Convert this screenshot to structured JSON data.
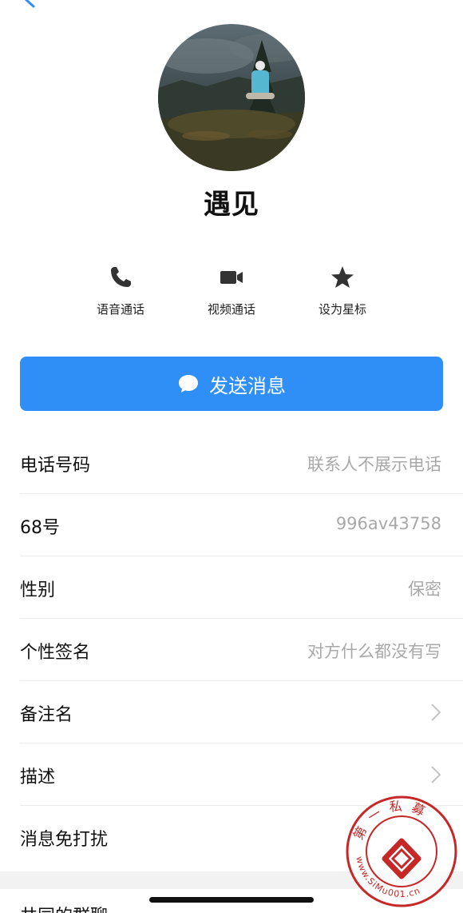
{
  "profile": {
    "name": "遇见"
  },
  "actions": [
    {
      "label": "语音通话",
      "icon": "phone-icon"
    },
    {
      "label": "视频通话",
      "icon": "video-camera-icon"
    },
    {
      "label": "设为星标",
      "icon": "star-icon"
    }
  ],
  "send_button": {
    "label": "发送消息",
    "icon": "chat-bubble-icon"
  },
  "info_rows": [
    {
      "key": "电话号码",
      "value": "联系人不展示电话"
    },
    {
      "key": "68号",
      "value": "996av43758"
    },
    {
      "key": "性别",
      "value": "保密"
    },
    {
      "key": "个性签名",
      "value": "对方什么都没有写"
    },
    {
      "key": "备注名",
      "value": ""
    },
    {
      "key": "描述",
      "value": ""
    },
    {
      "key": "消息免打扰",
      "value": ""
    }
  ],
  "bottom_row": {
    "label": "共同的群聊"
  },
  "watermark": {
    "text": "第一私募",
    "url": "www.SiMu001.cn"
  },
  "colors": {
    "accent": "#2f8ff7",
    "value_gray": "#a8a8a8",
    "divider": "#ececec"
  }
}
